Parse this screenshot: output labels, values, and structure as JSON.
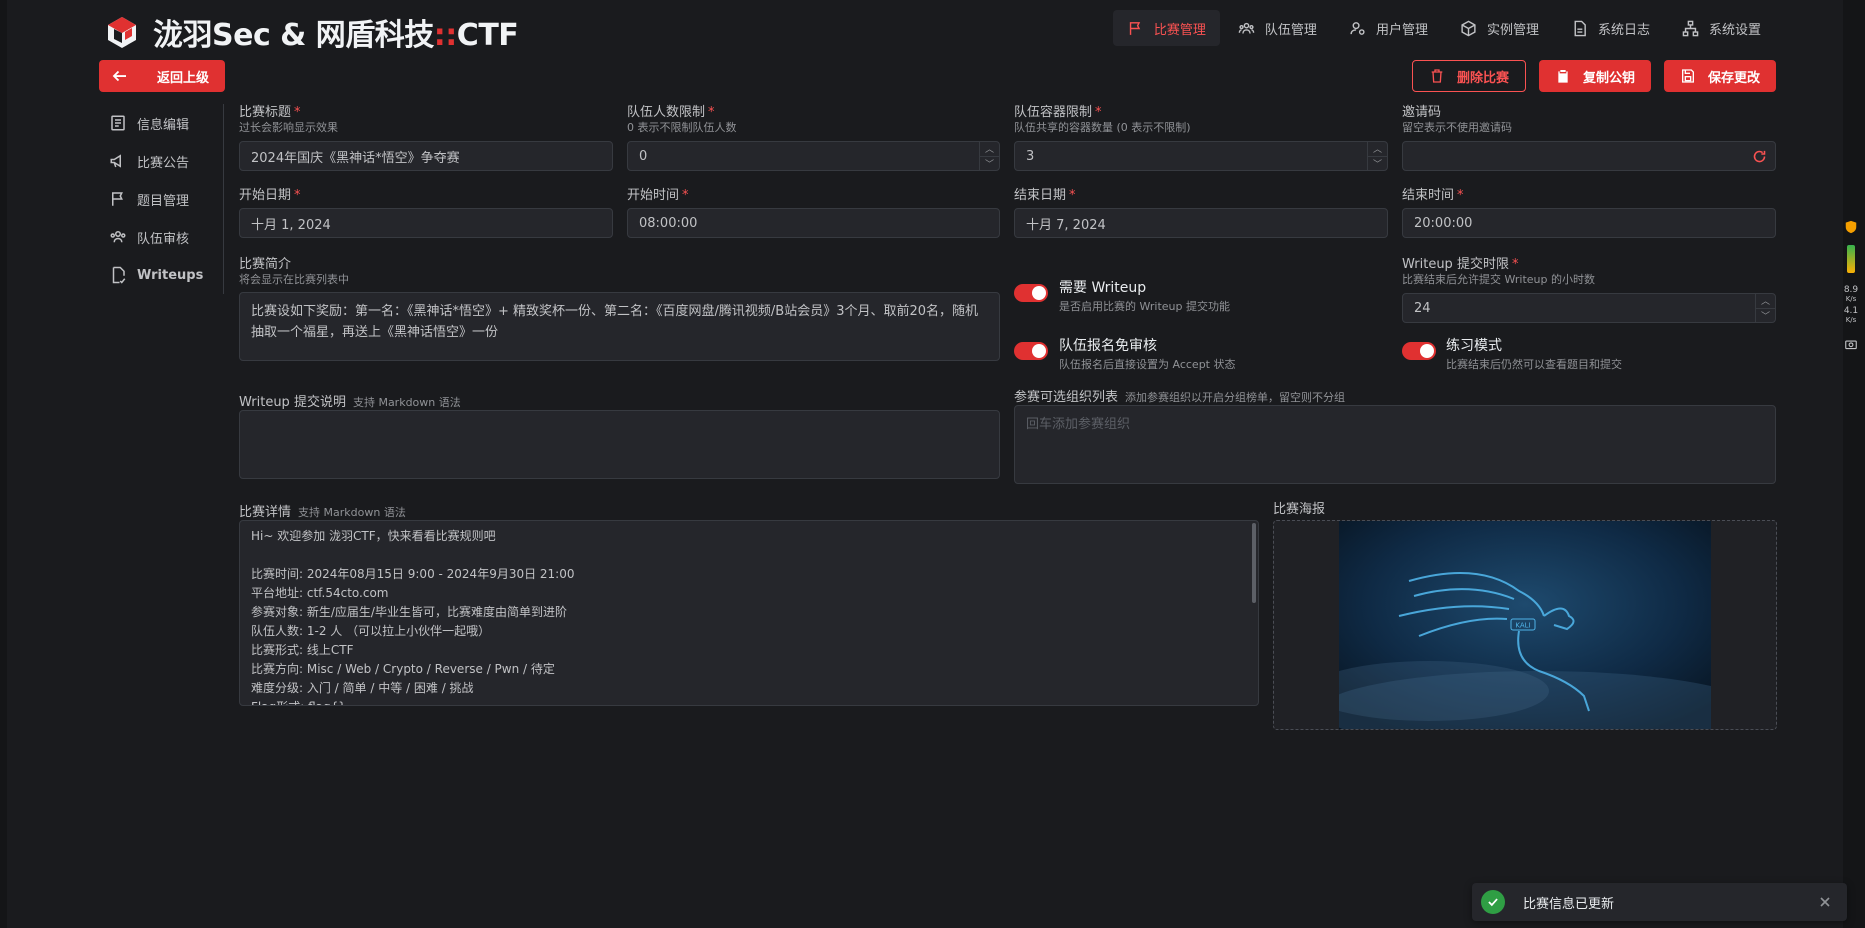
{
  "header": {
    "title_main": "泷羽Sec & 网盾科技",
    "title_sep": "::",
    "title_tail": "CTF",
    "nav": [
      {
        "label": "比赛管理",
        "icon": "flag-icon",
        "active": true
      },
      {
        "label": "队伍管理",
        "icon": "users-icon",
        "active": false
      },
      {
        "label": "用户管理",
        "icon": "user-gear-icon",
        "active": false
      },
      {
        "label": "实例管理",
        "icon": "cube-icon",
        "active": false
      },
      {
        "label": "系统日志",
        "icon": "document-icon",
        "active": false
      },
      {
        "label": "系统设置",
        "icon": "sitemap-icon",
        "active": false
      }
    ]
  },
  "back_label": "返回上级",
  "actions": {
    "delete": "删除比赛",
    "copy_key": "复制公钥",
    "save": "保存更改"
  },
  "sidebar": {
    "items": [
      {
        "label": "信息编辑",
        "icon": "info-edit-icon"
      },
      {
        "label": "比赛公告",
        "icon": "megaphone-icon"
      },
      {
        "label": "题目管理",
        "icon": "flag-icon"
      },
      {
        "label": "队伍审核",
        "icon": "team-review-icon"
      },
      {
        "label": "Writeups",
        "icon": "writeup-icon"
      }
    ]
  },
  "form": {
    "title": {
      "label": "比赛标题",
      "desc": "过长会影响显示效果",
      "value": "2024年国庆《黑神话*悟空》争夺赛"
    },
    "team_limit": {
      "label": "队伍人数限制",
      "desc": "0 表示不限制队伍人数",
      "value": "0"
    },
    "container_limit": {
      "label": "队伍容器限制",
      "desc": "队伍共享的容器数量 (0 表示不限制)",
      "value": "3"
    },
    "invite": {
      "label": "邀请码",
      "desc": "留空表示不使用邀请码",
      "value": ""
    },
    "start_date": {
      "label": "开始日期",
      "value": "十月 1, 2024"
    },
    "start_time": {
      "label": "开始时间",
      "value": "08:00:00"
    },
    "end_date": {
      "label": "结束日期",
      "value": "十月 7, 2024"
    },
    "end_time": {
      "label": "结束时间",
      "value": "20:00:00"
    },
    "summary": {
      "label": "比赛简介",
      "desc": "将会显示在比赛列表中",
      "value": "比赛设如下奖励：第一名：《黑神话*悟空》+ 精致奖杯一份、第二名：《百度网盘/腾讯视频/B站会员》3个月、取前20名，随机抽取一个福星，再送上《黑神话悟空》一份"
    },
    "need_writeup": {
      "label": "需要 Writeup",
      "desc": "是否启用比赛的 Writeup 提交功能",
      "on": true
    },
    "writeup_deadline": {
      "label": "Writeup 提交时限",
      "desc": "比赛结束后允许提交 Writeup 的小时数",
      "value": "24"
    },
    "auto_accept": {
      "label": "队伍报名免审核",
      "desc": "队伍报名后直接设置为 Accept 状态",
      "on": true
    },
    "practice": {
      "label": "练习模式",
      "desc": "比赛结束后仍然可以查看题目和提交",
      "on": true
    },
    "writeup_note": {
      "label": "Writeup 提交说明",
      "hint": "支持 Markdown 语法",
      "value": ""
    },
    "orgs": {
      "label": "参赛可选组织列表",
      "hint": "添加参赛组织以开启分组榜单，留空则不分组",
      "placeholder": "回车添加参赛组织"
    },
    "details": {
      "label": "比赛详情",
      "hint": "支持 Markdown 语法",
      "lines": [
        "Hi~ 欢迎参加 泷羽CTF，快来看看比赛规则吧",
        "",
        "比赛时间: 2024年08月15日 9:00 - 2024年9月30日 21:00",
        "平台地址: ctf.54cto.com",
        "参赛对象: 新生/应届生/毕业生皆可，比赛难度由简单到进阶",
        "队伍人数: 1-2 人 （可以拉上小伙伴一起哦）",
        "比赛形式: 线上CTF",
        "比赛方向: Misc / Web / Crypto / Reverse / Pwn / 待定",
        "难度分级: 入门 / 简单 / 中等 / 困难 / 挑战",
        "Flag形式: flag{}"
      ]
    },
    "poster": {
      "label": "比赛海报",
      "logo_text": "KALI"
    }
  },
  "toast": {
    "text": "比赛信息已更新"
  },
  "widget": {
    "down": "8.9",
    "up": "4.1",
    "unit": "K/s"
  },
  "colors": {
    "accent": "#e03131",
    "accent_light": "#fa5252",
    "bg": "#1a1b1e",
    "input_bg": "#25262b",
    "success": "#2f9e44"
  }
}
